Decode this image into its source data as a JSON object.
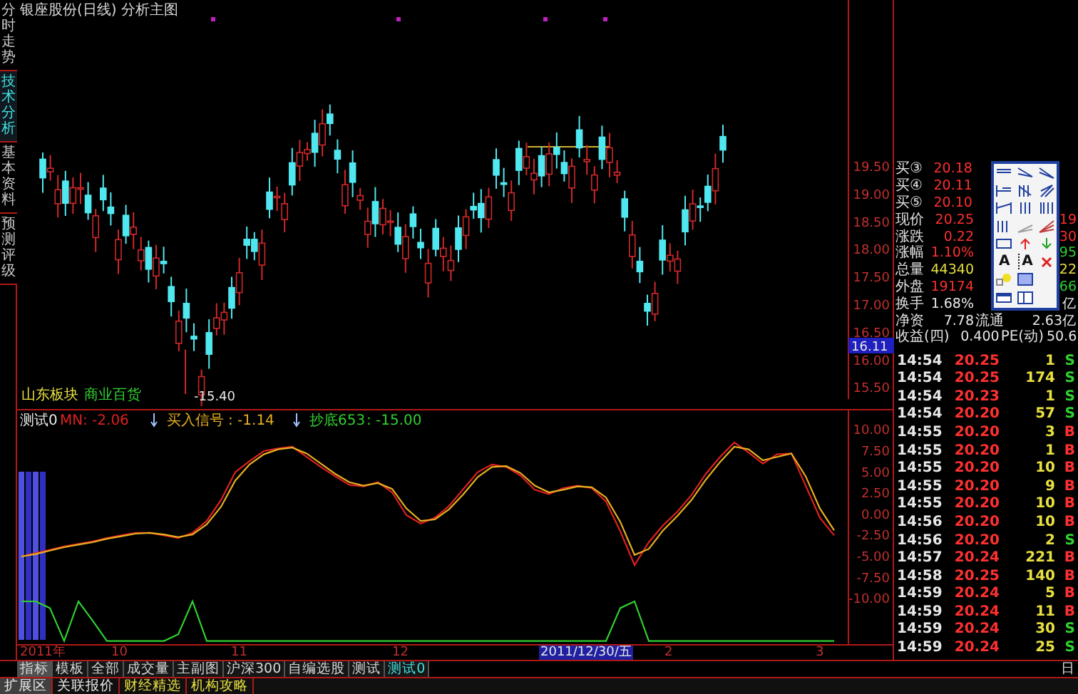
{
  "side_tabs": [
    {
      "label": "分时走势",
      "selected": false
    },
    {
      "label": "技术分析",
      "selected": true
    },
    {
      "label": "基本资料",
      "selected": false
    },
    {
      "label": "预测评级",
      "selected": false
    }
  ],
  "main_chart": {
    "title": "银座股份(日线) 分析主图",
    "y_labels": [
      "19.50",
      "19.00",
      "18.50",
      "18.00",
      "17.50",
      "17.00",
      "16.50",
      "16.00",
      "15.50"
    ],
    "cursor_price": "16.11",
    "low_label": "-15.40",
    "legend": [
      {
        "label": "山东板块",
        "color": "#e8e040"
      },
      {
        "label": "商业百货",
        "color": "#30d030"
      }
    ]
  },
  "indicator": {
    "chart_data": {
      "type": "line",
      "ylim": [
        -15.2,
        12.3
      ],
      "yticks": [
        {
          "value": 10,
          "label": "10.00"
        },
        {
          "value": 7.5,
          "label": "7.50"
        },
        {
          "value": 5,
          "label": "5.00"
        },
        {
          "value": 2.5,
          "label": "2.50"
        },
        {
          "value": 0,
          "label": "0.00"
        },
        {
          "value": -2.5,
          "label": "-2.50"
        },
        {
          "value": -5,
          "label": "-5.00"
        },
        {
          "value": -7.5,
          "label": "-7.50"
        },
        {
          "value": -10,
          "label": "-10.00"
        }
      ],
      "series": [
        {
          "name": "MN",
          "color": "#e02020",
          "values": [
            -5,
            -4.6,
            -4.2,
            -3.8,
            -3.5,
            -3.2,
            -2.8,
            -2.5,
            -2.2,
            -2.2,
            -2.5,
            -2.8,
            -2.2,
            -0.8,
            1.7,
            5,
            6.3,
            7.5,
            7.8,
            8,
            6.8,
            5.6,
            4.5,
            3.5,
            3.3,
            3.8,
            2.6,
            -0.1,
            -1.1,
            -0.4,
            1,
            3,
            5,
            5.9,
            5.6,
            4.6,
            2.9,
            2.4,
            3.1,
            3.4,
            3.1,
            1.5,
            -2,
            -6,
            -3.3,
            -1.3,
            0.3,
            2.3,
            4.8,
            6.8,
            8.5,
            7.3,
            6,
            7.1,
            7.2,
            3.4,
            -0.4,
            -2.5
          ]
        },
        {
          "name": "买入信号",
          "color": "#e8b020",
          "values": [
            -5,
            -4.7,
            -4.3,
            -3.9,
            -3.6,
            -3.3,
            -2.9,
            -2.6,
            -2.3,
            -2.2,
            -2.4,
            -2.7,
            -2.4,
            -1.2,
            0.9,
            4,
            5.9,
            7.1,
            7.7,
            7.9,
            7.2,
            6,
            4.8,
            3.8,
            3.4,
            3.7,
            3,
            0.7,
            -0.8,
            -0.6,
            0.6,
            2.4,
            4.4,
            5.6,
            5.7,
            4.9,
            3.4,
            2.6,
            2.9,
            3.3,
            3.2,
            2,
            -0.9,
            -4.8,
            -4.1,
            -1.9,
            -0.2,
            1.7,
            4.1,
            6.2,
            8,
            7.7,
            6.4,
            6.8,
            7.2,
            4.5,
            0.7,
            -1.9
          ]
        },
        {
          "name": "抄底653",
          "color": "#30d030",
          "values": [
            -10.3,
            -10.3,
            -11.1,
            -15,
            -10.3,
            -12.6,
            -15,
            -15,
            -15,
            -15,
            -15,
            -14.2,
            -10.3,
            -15,
            -15,
            -15,
            -15,
            -15,
            -15,
            -15,
            -15,
            -15,
            -15,
            -15,
            -15,
            -15,
            -15,
            -15,
            -15,
            -15,
            -15,
            -15,
            -15,
            -15,
            -15,
            -15,
            -15,
            -15,
            -15,
            -15,
            -15,
            -15,
            -11.1,
            -10.3,
            -15,
            -15,
            -15,
            -15,
            -15,
            -15,
            -15,
            -15,
            -15,
            -15,
            -15,
            -15,
            -15,
            -15
          ]
        }
      ]
    },
    "name": "测试0",
    "readings": [
      ": -2.06",
      ": -1.14",
      ": -15.00"
    ]
  },
  "date_axis": {
    "labels": [
      "2011年",
      "10",
      "11",
      "12",
      "2",
      "3"
    ],
    "cursor_date": "2011/12/30/五",
    "period": "日"
  },
  "quote": [
    {
      "label": "买③",
      "value": "20.18",
      "color": "#ff3030"
    },
    {
      "label": "买④",
      "value": "20.11",
      "color": "#ff3030"
    },
    {
      "label": "买⑤",
      "value": "20.10",
      "color": "#ff3030"
    },
    {
      "label": "现价",
      "value": "20.25",
      "color": "#ff3030",
      "tail": {
        "text": "19",
        "color": "#ff3030"
      }
    },
    {
      "label": "涨跌",
      "value": "0.22",
      "color": "#ff3030",
      "tail": {
        "text": "30",
        "color": "#ff3030"
      }
    },
    {
      "label": "涨幅",
      "value": "1.10%",
      "color": "#ff3030",
      "tail": {
        "text": "95",
        "color": "#30d030"
      }
    },
    {
      "label": "总量",
      "value": "44340",
      "color": "#e8e040",
      "tail": {
        "text": "22",
        "color": "#e8e040"
      }
    },
    {
      "label": "外盘",
      "value": "19174",
      "color": "#ff3030",
      "tail": {
        "text": "66",
        "color": "#30d030"
      }
    },
    {
      "label": "换手",
      "value": "1.68%",
      "color": "#e8e8e8",
      "tail": {
        "text": "亿",
        "color": "#e8e8e8"
      }
    },
    {
      "label": "净资",
      "value": "7.78",
      "color": "#e8e8e8",
      "label2": "流通",
      "value2": "2.63亿"
    },
    {
      "label": "收益(四)",
      "value": "0.400",
      "color": "#e8e8e8",
      "label2": "PE(动)",
      "value2": "50.6"
    }
  ],
  "toolbox": {
    "text_tools": [
      "A",
      "A"
    ]
  },
  "ticks": [
    {
      "time": "14:54",
      "price": "20.25",
      "volume": "1",
      "side": "S",
      "color": "#30d030"
    },
    {
      "time": "14:54",
      "price": "20.25",
      "volume": "174",
      "side": "S",
      "color": "#30d030"
    },
    {
      "time": "14:54",
      "price": "20.23",
      "volume": "1",
      "side": "S",
      "color": "#30d030"
    },
    {
      "time": "14:54",
      "price": "20.20",
      "volume": "57",
      "side": "S",
      "color": "#30d030"
    },
    {
      "time": "14:55",
      "price": "20.20",
      "volume": "3",
      "side": "B",
      "color": "#ff3030"
    },
    {
      "time": "14:55",
      "price": "20.20",
      "volume": "1",
      "side": "B",
      "color": "#ff3030"
    },
    {
      "time": "14:55",
      "price": "20.20",
      "volume": "10",
      "side": "B",
      "color": "#ff3030"
    },
    {
      "time": "14:55",
      "price": "20.20",
      "volume": "9",
      "side": "B",
      "color": "#ff3030"
    },
    {
      "time": "14:55",
      "price": "20.20",
      "volume": "10",
      "side": "B",
      "color": "#ff3030"
    },
    {
      "time": "14:56",
      "price": "20.20",
      "volume": "10",
      "side": "B",
      "color": "#ff3030"
    },
    {
      "time": "14:56",
      "price": "20.20",
      "volume": "2",
      "side": "S",
      "color": "#30d030"
    },
    {
      "time": "14:57",
      "price": "20.24",
      "volume": "221",
      "side": "B",
      "color": "#ff3030"
    },
    {
      "time": "14:58",
      "price": "20.25",
      "volume": "140",
      "side": "B",
      "color": "#ff3030"
    },
    {
      "time": "14:59",
      "price": "20.24",
      "volume": "5",
      "side": "B",
      "color": "#ff3030"
    },
    {
      "time": "14:59",
      "price": "20.24",
      "volume": "11",
      "side": "B",
      "color": "#ff3030"
    },
    {
      "time": "14:59",
      "price": "20.24",
      "volume": "30",
      "side": "S",
      "color": "#30d030"
    },
    {
      "time": "14:59",
      "price": "20.24",
      "volume": "25",
      "side": "S",
      "color": "#30d030"
    }
  ],
  "chart_tabs": [
    {
      "label": "指标",
      "kind": "label",
      "selected": false
    },
    {
      "label": "模板",
      "kind": "tab",
      "selected": false
    },
    {
      "label": "全部",
      "kind": "tab",
      "selected": false
    },
    {
      "label": "成交量",
      "kind": "tab",
      "selected": false
    },
    {
      "label": "主副图",
      "kind": "tab",
      "selected": false
    },
    {
      "label": "沪深300",
      "kind": "tab",
      "selected": false
    },
    {
      "label": "自编选股",
      "kind": "tab",
      "selected": false
    },
    {
      "label": "测试",
      "kind": "tab",
      "selected": false
    },
    {
      "label": "测试0",
      "kind": "tab",
      "selected": true
    }
  ],
  "bottom_tabs": [
    {
      "label": "扩展区",
      "kind": "plain",
      "selected": true
    },
    {
      "label": "关联报价",
      "kind": "plain",
      "selected": false
    },
    {
      "label": "财经精选",
      "kind": "featured",
      "selected": false
    },
    {
      "label": "机构攻略",
      "kind": "featured",
      "selected": false
    }
  ]
}
